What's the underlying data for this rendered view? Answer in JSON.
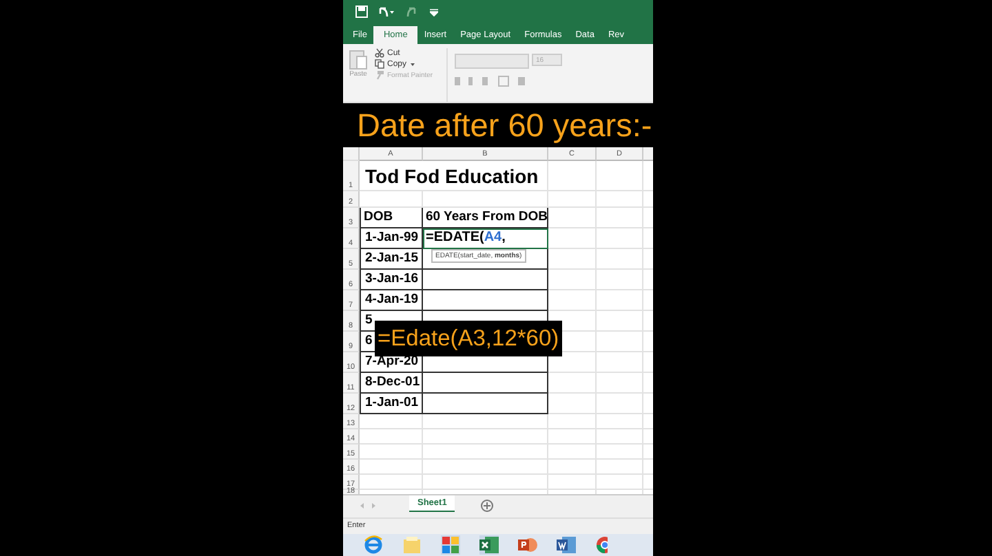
{
  "ribbon_tabs": [
    {
      "label": "File",
      "selected": false
    },
    {
      "label": "Home",
      "selected": true
    },
    {
      "label": "Insert",
      "selected": false
    },
    {
      "label": "Page Layout",
      "selected": false
    },
    {
      "label": "Formulas",
      "selected": false
    },
    {
      "label": "Data",
      "selected": false
    },
    {
      "label": "Rev",
      "selected": false
    }
  ],
  "clipboard": {
    "paste": "Paste",
    "cut": "Cut",
    "copy": "Copy",
    "format_painter": "Format Painter"
  },
  "font": {
    "size": "16"
  },
  "banner": "Date after 60 years:-",
  "columns": [
    "A",
    "B",
    "C",
    "D"
  ],
  "rows": [
    {
      "number": "1",
      "kind": "title",
      "text": "Tod Fod Education"
    },
    {
      "number": "2",
      "kind": "blank"
    },
    {
      "number": "3",
      "kind": "header",
      "a": "DOB",
      "b": "60 Years From DOB"
    },
    {
      "number": "4",
      "kind": "formula",
      "a": "1-Jan-99",
      "prefix": "=EDATE(",
      "ref": "A4",
      "suffix": ",",
      "tooltip": "EDATE(start_date, **months**)"
    },
    {
      "number": "5",
      "kind": "data",
      "a": "2-Jan-15"
    },
    {
      "number": "6",
      "kind": "data",
      "a": "3-Jan-16"
    },
    {
      "number": "7",
      "kind": "data",
      "a": "4-Jan-19"
    },
    {
      "number": "8",
      "kind": "data",
      "a": "5"
    },
    {
      "number": "9",
      "kind": "data",
      "a": "6"
    },
    {
      "number": "10",
      "kind": "data",
      "a": "7-Apr-20"
    },
    {
      "number": "11",
      "kind": "data",
      "a": "8-Dec-01"
    },
    {
      "number": "12",
      "kind": "data",
      "a": "1-Jan-01"
    },
    {
      "number": "13",
      "kind": "empty"
    },
    {
      "number": "14",
      "kind": "empty"
    },
    {
      "number": "15",
      "kind": "empty"
    },
    {
      "number": "16",
      "kind": "empty"
    },
    {
      "number": "17",
      "kind": "empty"
    },
    {
      "number": "18",
      "kind": "empty"
    }
  ],
  "overlay": "=Edate(A3,12*60)",
  "sheets": [
    {
      "label": "Sheet1",
      "selected": true
    }
  ],
  "status": "Enter"
}
